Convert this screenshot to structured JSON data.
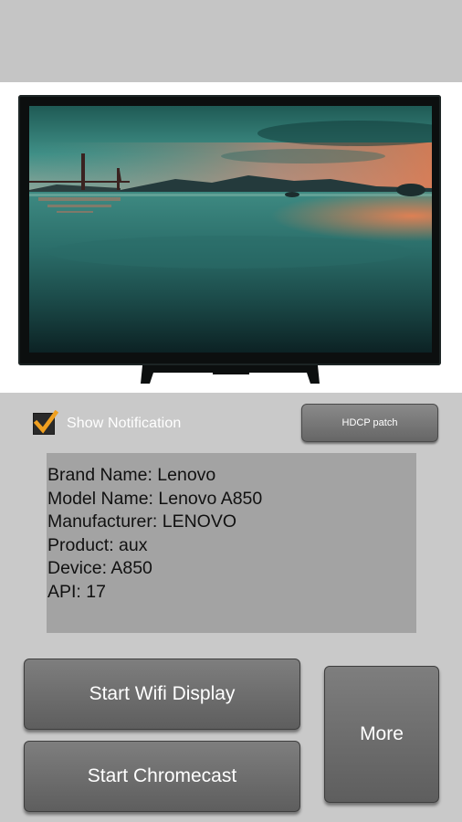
{
  "checkbox": {
    "label": "Show Notification",
    "checked": true,
    "check_color": "#f0a020"
  },
  "buttons": {
    "hdcp": "HDCP patch",
    "wifi": "Start Wifi Display",
    "chromecast": "Start Chromecast",
    "more": "More"
  },
  "device_info": {
    "lines": [
      "Brand Name: Lenovo",
      "Model Name: Lenovo A850",
      "Manufacturer: LENOVO",
      "Product: aux",
      "Device: A850",
      "API: 17"
    ]
  },
  "colors": {
    "background": "#c9c9c9",
    "button": "#6e6e6e",
    "info_box": "#a3a3a3"
  }
}
